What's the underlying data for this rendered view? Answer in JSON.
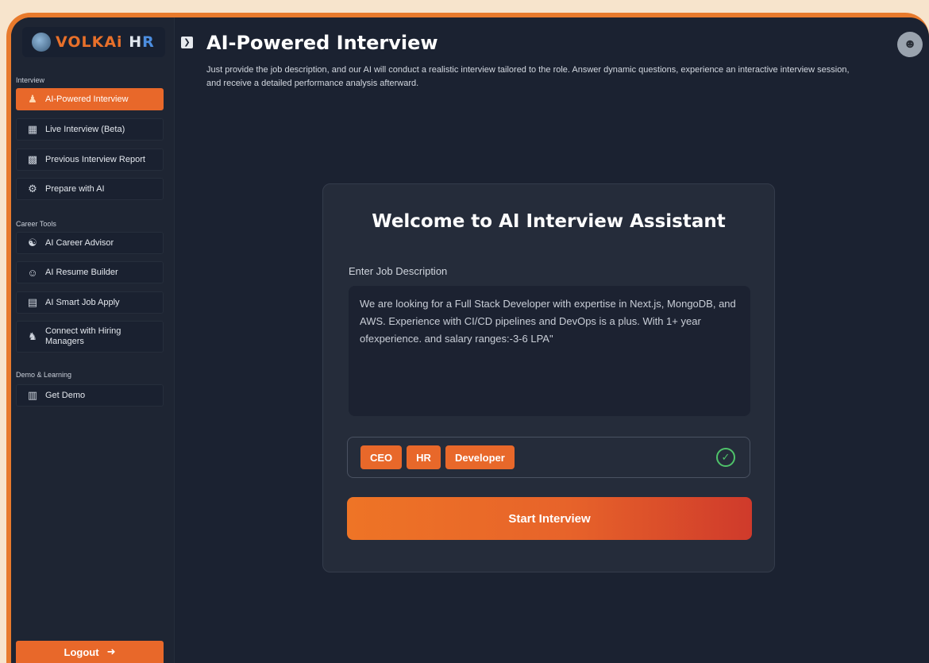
{
  "brand": {
    "logo_part1": "VOLKAi",
    "logo_part2": " H",
    "logo_part3": "R"
  },
  "sidebar": {
    "sections": [
      {
        "label": "Interview"
      },
      {
        "label": "Career Tools"
      },
      {
        "label": "Demo & Learning"
      }
    ],
    "items": [
      {
        "label": "AI-Powered Interview",
        "icon": "people-icon",
        "active": true
      },
      {
        "label": "Live Interview (Beta)",
        "icon": "video-call-icon"
      },
      {
        "label": "Previous Interview Report",
        "icon": "report-icon"
      },
      {
        "label": "Prepare with AI",
        "icon": "robot-icon"
      },
      {
        "label": "AI Career Advisor",
        "icon": "advisor-icon"
      },
      {
        "label": "AI Resume Builder",
        "icon": "team-icon"
      },
      {
        "label": "AI Smart Job Apply",
        "icon": "laptop-icon"
      },
      {
        "label": "Connect with Hiring Managers",
        "icon": "meeting-icon"
      },
      {
        "label": "Get Demo",
        "icon": "presentation-icon"
      }
    ],
    "logout_label": "Logout"
  },
  "header": {
    "title": "AI-Powered Interview",
    "description": "Just provide the job description, and our AI will conduct a realistic interview tailored to the role. Answer dynamic questions, experience an interactive interview session, and receive a detailed performance analysis afterward."
  },
  "card": {
    "title": "Welcome to AI Interview Assistant",
    "field_label": "Enter Job Description",
    "job_description": "We are looking for a Full Stack Developer with expertise in Next.js, MongoDB, and AWS. Experience with CI/CD pipelines and DevOps is a plus. With 1+ year ofexperience. and salary ranges:-3-6 LPA\"",
    "roles": [
      "CEO",
      "HR",
      "Developer"
    ],
    "start_label": "Start Interview"
  },
  "colors": {
    "accent": "#e8682a",
    "background": "#1b2231",
    "frame": "#e87a2c",
    "success": "#4fc36a"
  }
}
